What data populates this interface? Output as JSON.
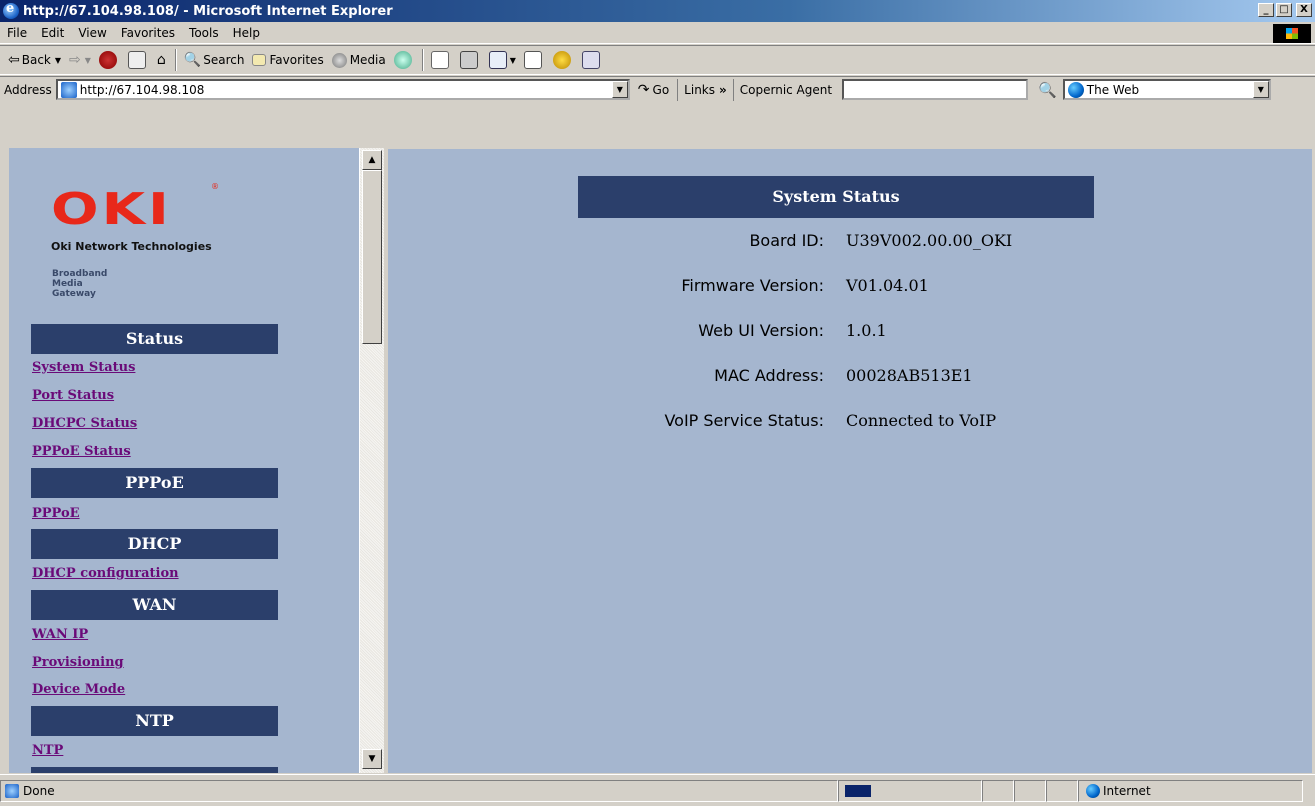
{
  "window": {
    "title": "http://67.104.98.108/ - Microsoft Internet Explorer",
    "min": "_",
    "max": "□",
    "close": "X"
  },
  "menu": [
    "File",
    "Edit",
    "View",
    "Favorites",
    "Tools",
    "Help"
  ],
  "toolbar": {
    "back": "Back",
    "search": "Search",
    "favorites": "Favorites",
    "media": "Media"
  },
  "address": {
    "label": "Address",
    "url": "http://67.104.98.108",
    "go": "Go",
    "links": "Links",
    "links_chevron": "»",
    "agent_label": "Copernic Agent",
    "agent_value": "",
    "web_select": "The Web"
  },
  "sidebar": {
    "brand": "OKI",
    "brand_reg": "®",
    "company": "Oki Network Technologies",
    "product_lines": [
      "Broadband",
      "Media",
      "Gateway"
    ],
    "sections": [
      {
        "title": "Status",
        "links": [
          "System Status",
          "Port Status",
          "DHCPC Status",
          "PPPoE Status"
        ]
      },
      {
        "title": "PPPoE",
        "links": [
          "PPPoE"
        ]
      },
      {
        "title": "DHCP",
        "links": [
          "DHCP configuration"
        ]
      },
      {
        "title": "WAN",
        "links": [
          "WAN IP",
          "Provisioning",
          "Device Mode"
        ]
      },
      {
        "title": "NTP",
        "links": [
          "NTP"
        ]
      }
    ]
  },
  "main": {
    "heading": "System Status",
    "rows": [
      {
        "label": "Board ID:",
        "value": "U39V002.00.00_OKI"
      },
      {
        "label": "Firmware Version:",
        "value": "V01.04.01"
      },
      {
        "label": "Web UI Version:",
        "value": "1.0.1"
      },
      {
        "label": "MAC Address:",
        "value": "00028AB513E1"
      },
      {
        "label": "VoIP Service Status:",
        "value": "Connected to VoIP"
      }
    ]
  },
  "status": {
    "text": "Done",
    "zone": "Internet"
  }
}
